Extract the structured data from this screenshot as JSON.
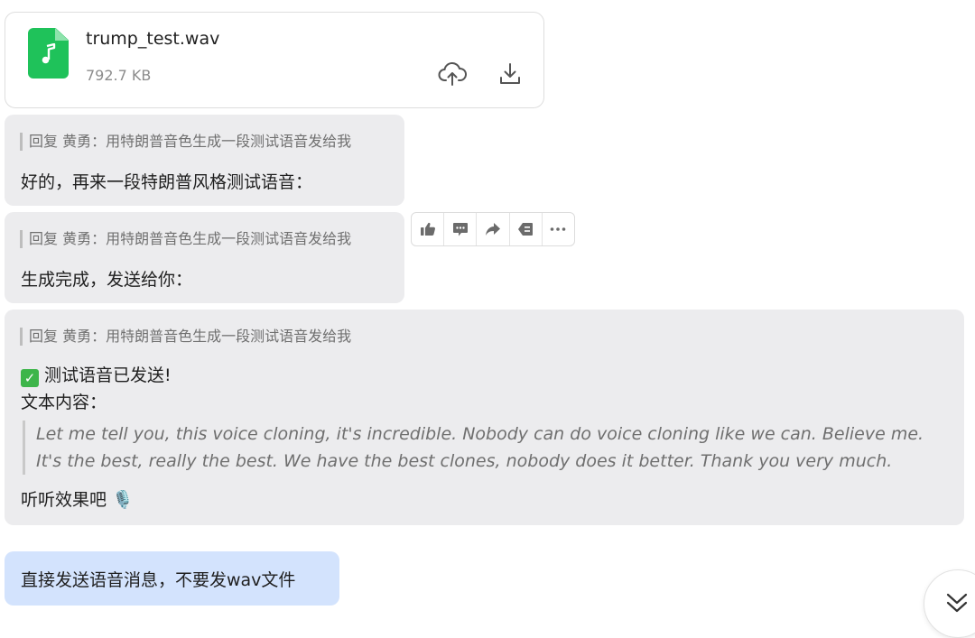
{
  "file": {
    "name": "trump_test.wav",
    "size": "792.7 KB",
    "icon": "audio-file-icon",
    "accent": "#1fc25a"
  },
  "messages": [
    {
      "quote": "回复 黄勇：用特朗普音色生成一段测试语音发给我",
      "text": "好的，再来一段特朗普风格测试语音："
    },
    {
      "quote": "回复 黄勇：用特朗普音色生成一段测试语音发给我",
      "text": "生成完成，发送给你："
    },
    {
      "quote": "回复 黄勇：用特朗普音色生成一段测试语音发给我",
      "status": "测试语音已发送!",
      "label": "文本内容：",
      "blockquote_line1": "Let me tell you, this voice cloning, it's incredible. Nobody can do voice cloning like we can. Believe me.",
      "blockquote_line2": "It's the best, really the best. We have the best clones, nobody does it better. Thank you very much.",
      "closing": "听听效果吧 🎙️"
    }
  ],
  "toolbar": [
    "thumbs-up-icon",
    "comment-icon",
    "share-icon",
    "reply-icon",
    "more-icon"
  ],
  "user_message": "直接发送语音消息，不要发wav文件",
  "colors": {
    "bubble": "#ececee",
    "user_bubble": "#d3e3fd"
  }
}
